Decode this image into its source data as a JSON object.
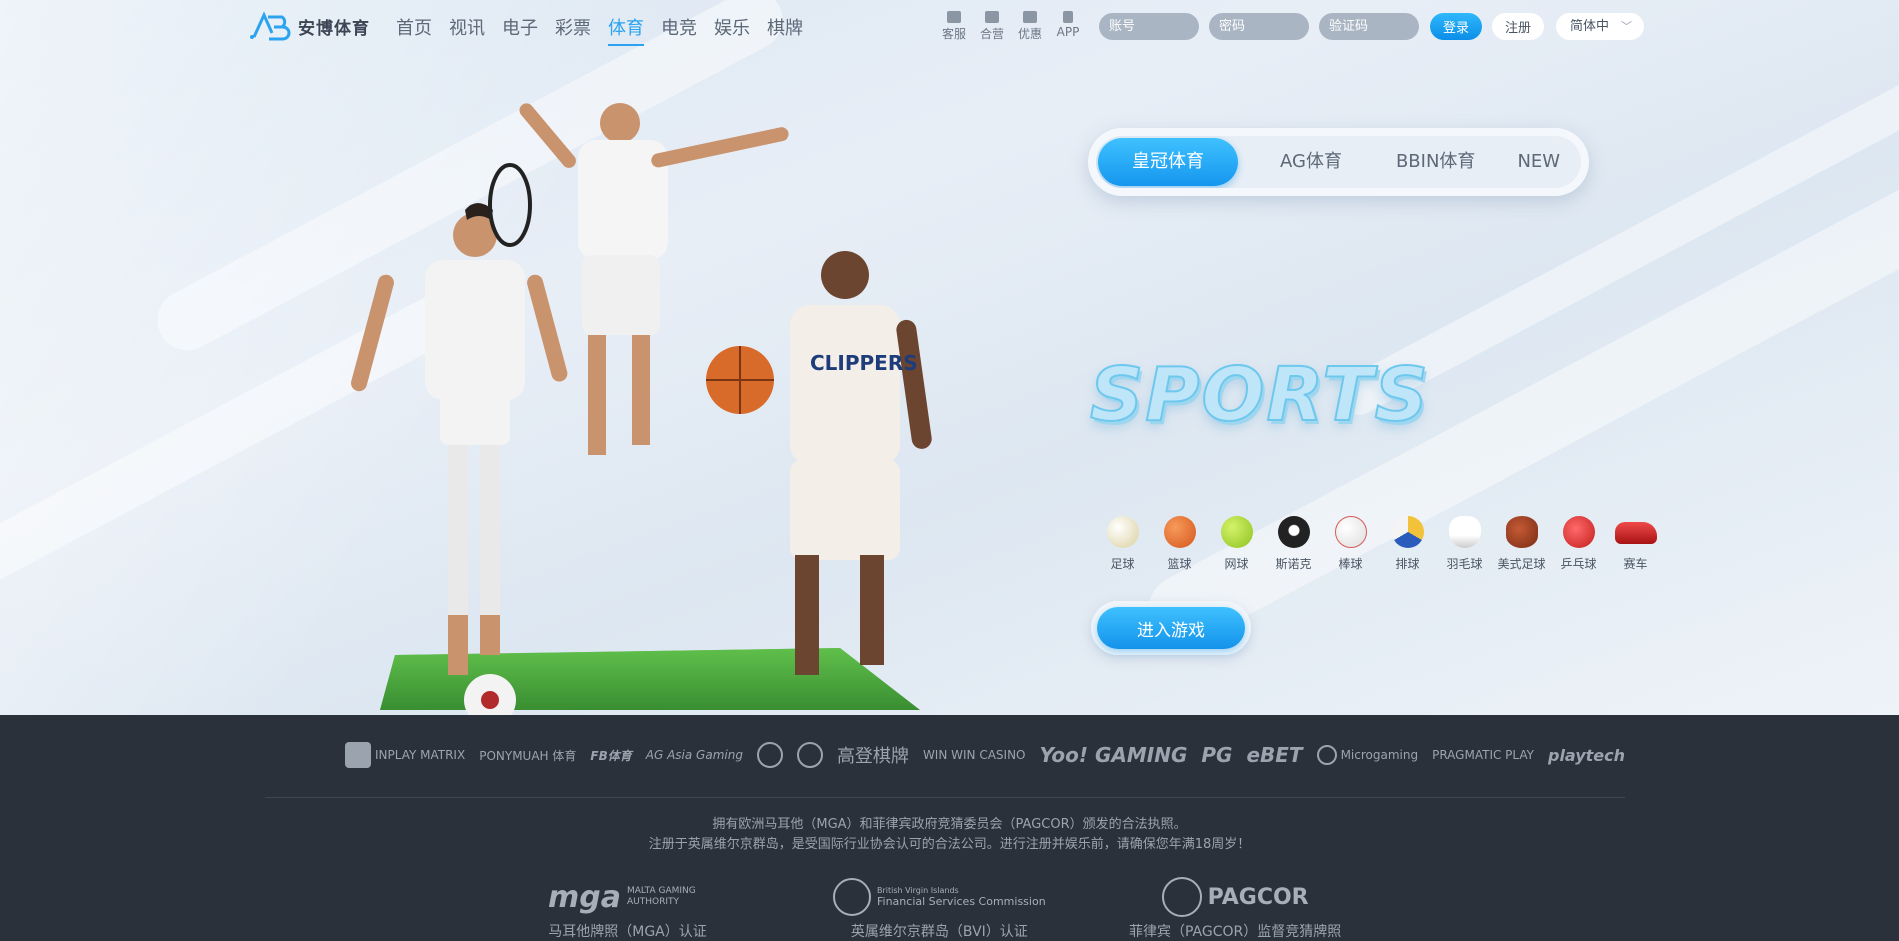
{
  "brand": {
    "name": "安博体育"
  },
  "nav": {
    "items": [
      "首页",
      "视讯",
      "电子",
      "彩票",
      "体育",
      "电竞",
      "娱乐",
      "棋牌"
    ],
    "active": "体育"
  },
  "quick_links": [
    "客服",
    "合营",
    "优惠",
    "APP"
  ],
  "login": {
    "account_placeholder": "账号",
    "password_placeholder": "密码",
    "captcha_placeholder": "验证码",
    "login_label": "登录",
    "register_label": "注册",
    "language": "简体中"
  },
  "tabs": [
    "皇冠体育",
    "AG体育",
    "BBIN体育",
    "NEW"
  ],
  "hero": {
    "title": "SPORTS",
    "enter_label": "进入游戏"
  },
  "sports": [
    {
      "label": "足球",
      "icon": "soccer-ball-icon",
      "color": "#e8dfb8"
    },
    {
      "label": "篮球",
      "icon": "basketball-icon",
      "color": "#e5682c"
    },
    {
      "label": "网球",
      "icon": "tennis-ball-icon",
      "color": "#a4d43a"
    },
    {
      "label": "斯诺克",
      "icon": "billiard-ball-icon",
      "color": "#1b1b1b"
    },
    {
      "label": "棒球",
      "icon": "baseball-icon",
      "color": "#f2eeee"
    },
    {
      "label": "排球",
      "icon": "volleyball-icon",
      "color": "#f2c33a"
    },
    {
      "label": "羽毛球",
      "icon": "shuttlecock-icon",
      "color": "#f4f4f4"
    },
    {
      "label": "美式足球",
      "icon": "american-football-icon",
      "color": "#9a3d22"
    },
    {
      "label": "乒乓球",
      "icon": "table-tennis-icon",
      "color": "#e23a3a"
    },
    {
      "label": "赛车",
      "icon": "race-car-icon",
      "color": "#d8282c"
    }
  ],
  "partners": [
    "INPLAY MATRIX",
    "PONYMUAH 体育",
    "FB体育",
    "AG Asia Gaming",
    "",
    "",
    "高登棋牌",
    "WIN WIN CASINO",
    "Yoo! GAMING",
    "PG",
    "eBET",
    "Microgaming",
    "PRAGMATIC PLAY",
    "playtech"
  ],
  "legal": {
    "line1": "拥有欧洲马耳他（MGA）和菲律宾政府竞猜委员会（PAGCOR）颁发的合法执照。",
    "line2": "注册于英属维尔京群岛，是受国际行业协会认可的合法公司。进行注册并娱乐前，请确保您年满18周岁！"
  },
  "licenses": [
    {
      "logo": "mga",
      "sub": "MALTA GAMING AUTHORITY",
      "name": "马耳他牌照（MGA）认证"
    },
    {
      "logo": "British Virgin Islands",
      "sub": "Financial Services Commission",
      "name": "英属维尔京群岛（BVI）认证"
    },
    {
      "logo": "PAGCOR",
      "sub": "",
      "name": "菲律宾（PAGCOR）监督竞猜牌照"
    }
  ]
}
